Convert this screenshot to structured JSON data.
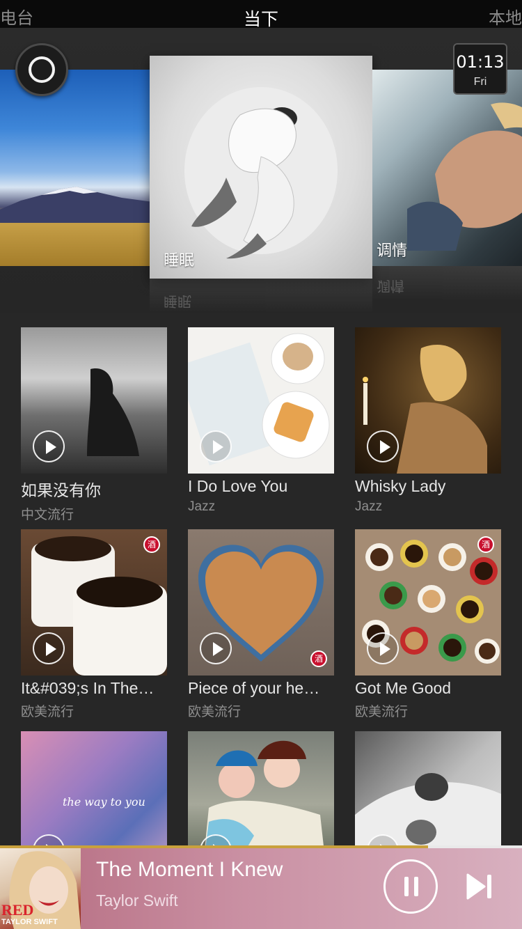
{
  "tabs": {
    "left": "电台",
    "center": "当下",
    "right": "本地"
  },
  "carousel": {
    "center_label": "睡眠",
    "right_label": "调情",
    "center_reflection": "睡眠",
    "right_reflection": "调情"
  },
  "clock": {
    "time": "01:13",
    "day": "Fri"
  },
  "grid": [
    {
      "title": "如果没有你",
      "genre": "中文流行",
      "icon": "play-icon",
      "badge": false
    },
    {
      "title": "I Do Love You",
      "genre": "Jazz",
      "icon": "play-icon",
      "badge": false
    },
    {
      "title": "Whisky Lady",
      "genre": "Jazz",
      "icon": "play-icon",
      "badge": false
    },
    {
      "title": "It&#039;s In The…",
      "genre": "欧美流行",
      "icon": "play-icon",
      "badge": true
    },
    {
      "title": "Piece of your he…",
      "genre": "欧美流行",
      "icon": "play-icon",
      "badge": true
    },
    {
      "title": "Got Me Good",
      "genre": "欧美流行",
      "icon": "play-icon",
      "badge": true
    },
    {
      "title": "",
      "genre": "",
      "icon": "play-icon",
      "badge": false,
      "overlay_text": "the way to you"
    },
    {
      "title": "",
      "genre": "",
      "icon": "play-icon",
      "badge": false
    },
    {
      "title": "",
      "genre": "",
      "icon": "play-icon",
      "badge": false
    }
  ],
  "now_playing": {
    "title": "The Moment I Knew",
    "artist": "Taylor Swift",
    "cover_red": "RED",
    "cover_artist": "TAYLOR SWIFT",
    "progress": 0.82,
    "icons": {
      "pause": "pause-icon",
      "next": "skip-next-icon"
    }
  },
  "colors": {
    "accent": "#c9a13c",
    "background": "#272727",
    "badge": "#c8102e"
  }
}
